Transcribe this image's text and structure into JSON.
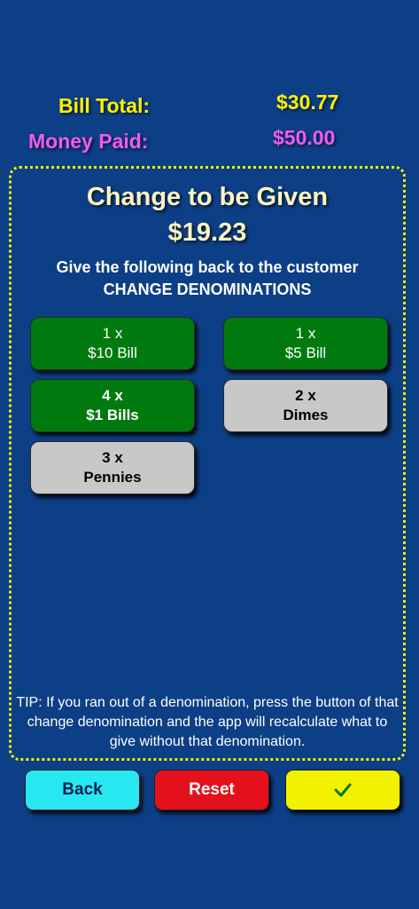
{
  "summary": {
    "bill_total_label": "Bill Total:",
    "bill_total_value": "$30.77",
    "money_paid_label": "Money Paid:",
    "money_paid_value": "$50.00"
  },
  "panel": {
    "title": "Change to be Given",
    "amount": "$19.23",
    "instruction": "Give the following back to the customer",
    "subtitle": "CHANGE DENOMINATIONS",
    "denominations": [
      {
        "count": "1 x",
        "name": "$10 Bill",
        "status": "available"
      },
      {
        "count": "1 x",
        "name": "$5 Bill",
        "status": "available"
      },
      {
        "count": "4 x",
        "name": "$1 Bills",
        "status": "available"
      },
      {
        "count": "2 x",
        "name": "Dimes",
        "status": "unavailable"
      },
      {
        "count": "3 x",
        "name": "Pennies",
        "status": "unavailable"
      }
    ],
    "tip": "TIP: If you ran out of a denomination, press the button of that change denomination and the app will recalculate what to give without that denomination."
  },
  "actions": {
    "back_label": "Back",
    "reset_label": "Reset",
    "confirm_icon": "checkmark-icon"
  },
  "colors": {
    "background": "#0d3f86",
    "bill_total": "#fff200",
    "money_paid": "#f05af0",
    "available_denomination": "#007a0e",
    "unavailable_denomination": "#c8c8c8",
    "back_button": "#27e8f0",
    "reset_button": "#e4101c",
    "confirm_button": "#f2f200"
  }
}
